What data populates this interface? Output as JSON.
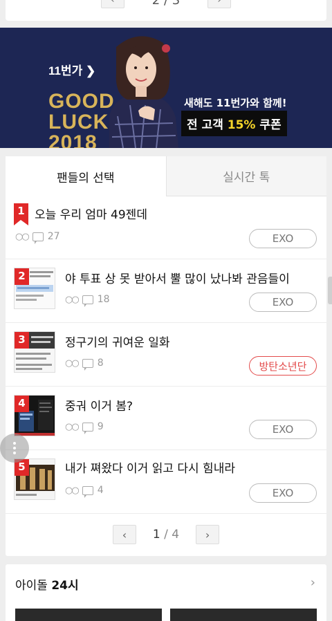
{
  "top_pager": {
    "current": "2",
    "sep": "/",
    "total": "3",
    "prev": "‹",
    "next": "›"
  },
  "banner": {
    "logo": "11번가",
    "good_luck": "GOOD",
    "good_luck2": "LUCK",
    "year": "2018",
    "headline": "새해도 11번가와 함께!",
    "coupon_prefix": "전 고객 ",
    "coupon_pct": "15%",
    "coupon_suffix": " 쿠폰"
  },
  "tabs": [
    {
      "label": "팬들의 선택",
      "active": true
    },
    {
      "label": "실시간 톡",
      "active": false
    }
  ],
  "posts": [
    {
      "rank": "1",
      "title": "오늘 우리 엄마 49젠데",
      "views": "○○",
      "comments": "27",
      "tag": "EXO",
      "tag_color": "gray",
      "has_thumb": false
    },
    {
      "rank": "2",
      "title": "야 투표 상 못 받아서 뿔 많이 났나봐 관음들이",
      "views": "○○",
      "comments": "18",
      "tag": "EXO",
      "tag_color": "gray",
      "has_thumb": true
    },
    {
      "rank": "3",
      "title": "정구기의 귀여운 일화",
      "views": "○○",
      "comments": "8",
      "tag": "방탄소년단",
      "tag_color": "red",
      "has_thumb": true
    },
    {
      "rank": "4",
      "title": "중궈 이거 봄?",
      "views": "○○",
      "comments": "9",
      "tag": "EXO",
      "tag_color": "gray",
      "has_thumb": true
    },
    {
      "rank": "5",
      "title": "내가 쪄왔다 이거 읽고 다시 힘내라",
      "views": "○○",
      "comments": "4",
      "tag": "EXO",
      "tag_color": "gray",
      "has_thumb": true
    }
  ],
  "pager": {
    "prev": "‹",
    "current": "1",
    "sep": "/",
    "total": "4",
    "next": "›"
  },
  "idol_section": {
    "title_prefix": "아이돌 ",
    "title_bold": "24시",
    "chevron": "›"
  },
  "colors": {
    "banner_bg": "#1d2654",
    "rank_red": "#e02828",
    "gold": "#d8b45a"
  }
}
